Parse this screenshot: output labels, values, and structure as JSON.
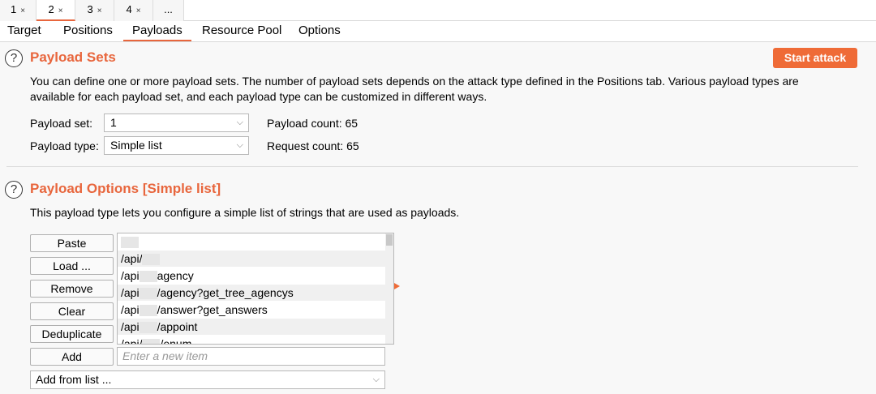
{
  "attack_tabs": [
    {
      "label": "1",
      "close": "×"
    },
    {
      "label": "2",
      "close": "×"
    },
    {
      "label": "3",
      "close": "×"
    },
    {
      "label": "4",
      "close": "×"
    },
    {
      "label": "..."
    }
  ],
  "sub_tabs": [
    "Target",
    "Positions",
    "Payloads",
    "Resource Pool",
    "Options"
  ],
  "payload_sets": {
    "title": "Payload Sets",
    "start_label": "Start attack",
    "description_line1": "You can define one or more payload sets. The number of payload sets depends on the attack type defined in the Positions tab. Various payload types are",
    "description_line2": "available for each payload set, and each payload type can be customized in different ways.",
    "set_label": "Payload set:",
    "set_value": "1",
    "type_label": "Payload type:",
    "type_value": "Simple list",
    "payload_count_label": "Payload count:",
    "payload_count": "65",
    "request_count_label": "Request count:",
    "request_count": "65"
  },
  "payload_options": {
    "title": "Payload Options [Simple list]",
    "description": "This payload type lets you configure a simple list of strings that are used as payloads.",
    "buttons": [
      "Paste",
      "Load ...",
      "Remove",
      "Clear",
      "Deduplicate",
      "Add"
    ],
    "list_items": [
      {
        "prefix": "",
        "suffix": ""
      },
      {
        "prefix": "/api/",
        "suffix": ""
      },
      {
        "prefix": "/api",
        "suffix": "agency"
      },
      {
        "prefix": "/api",
        "suffix": "/agency?get_tree_agencys"
      },
      {
        "prefix": "/api",
        "suffix": "/answer?get_answers"
      },
      {
        "prefix": "/api",
        "suffix": "/appoint"
      },
      {
        "prefix": "/api/",
        "suffix": "/enum"
      }
    ],
    "add_placeholder": "Enter a new item",
    "add_from_list": "Add from list ..."
  },
  "help_icon_glyph": "?",
  "chevron_glyph": "⌵",
  "accent_color": "#e8663d"
}
